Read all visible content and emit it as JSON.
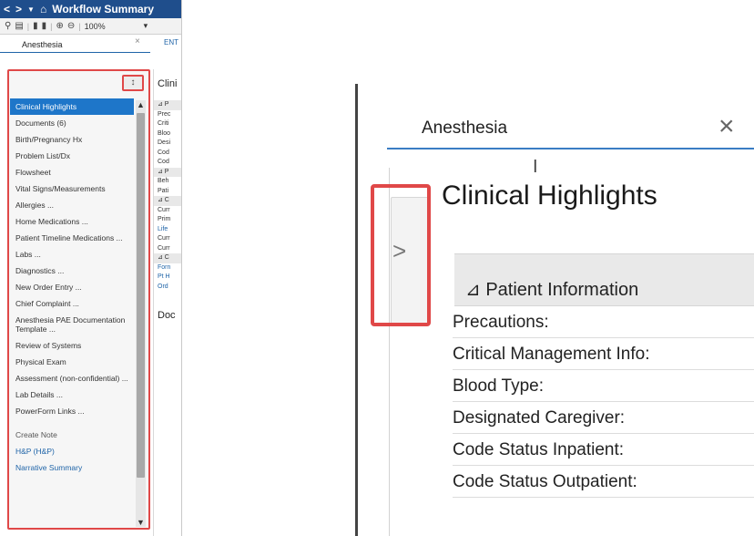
{
  "left": {
    "title": "Workflow Summary",
    "nav_back": "<",
    "nav_forward": ">",
    "zoom": "100%",
    "tab_label": "Anesthesia",
    "tab_close": "×",
    "tab_overflow": "ENT",
    "pin_glyph": "↕",
    "menu": [
      {
        "label": "Clinical Highlights",
        "selected": true
      },
      {
        "label": "Documents (6)"
      },
      {
        "label": "Birth/Pregnancy Hx"
      },
      {
        "label": "Problem List/Dx"
      },
      {
        "label": "Flowsheet"
      },
      {
        "label": "Vital Signs/Measurements"
      },
      {
        "label": "Allergies ..."
      },
      {
        "label": "Home Medications ..."
      },
      {
        "label": "Patient Timeline Medications ..."
      },
      {
        "label": "Labs ..."
      },
      {
        "label": "Diagnostics ..."
      },
      {
        "label": "New Order Entry ..."
      },
      {
        "label": "Chief Complaint ..."
      },
      {
        "label": "Anesthesia PAE Documentation Template ..."
      },
      {
        "label": "Review of Systems"
      },
      {
        "label": "Physical Exam"
      },
      {
        "label": "Assessment (non-confidential) ..."
      },
      {
        "label": "Lab Details ..."
      },
      {
        "label": "PowerForm Links ..."
      }
    ],
    "create_note_header": "Create Note",
    "notes": [
      "H&P (H&P)",
      "Narrative Summary"
    ],
    "content_title": "Clini",
    "content_rows": [
      "⊿ P",
      "Prec",
      "Criti",
      "Bloo",
      "Desi",
      "Cod",
      "Cod",
      "⊿ P",
      "Beh",
      "Pati",
      "⊿ C",
      "Curr",
      "Prim",
      "Life",
      "Curr",
      "Curr",
      "⊿ C",
      "Forn",
      "Pt H",
      "Ord"
    ],
    "content_doc": "Doc"
  },
  "right": {
    "tab_label": "Anesthesia",
    "tab_close": "×",
    "heading": "Clinical Highlights",
    "expand_glyph": ">",
    "section_title": "⊿ Patient Information",
    "fields": [
      "Precautions:",
      "Critical Management Info:",
      "Blood Type:",
      "Designated Caregiver:",
      "Code Status Inpatient:",
      "Code Status Outpatient:"
    ]
  },
  "colors": {
    "title_bar": "#1f4e8c",
    "selected": "#1e76c9",
    "highlight_box": "#e04848",
    "link": "#1f64a8"
  }
}
